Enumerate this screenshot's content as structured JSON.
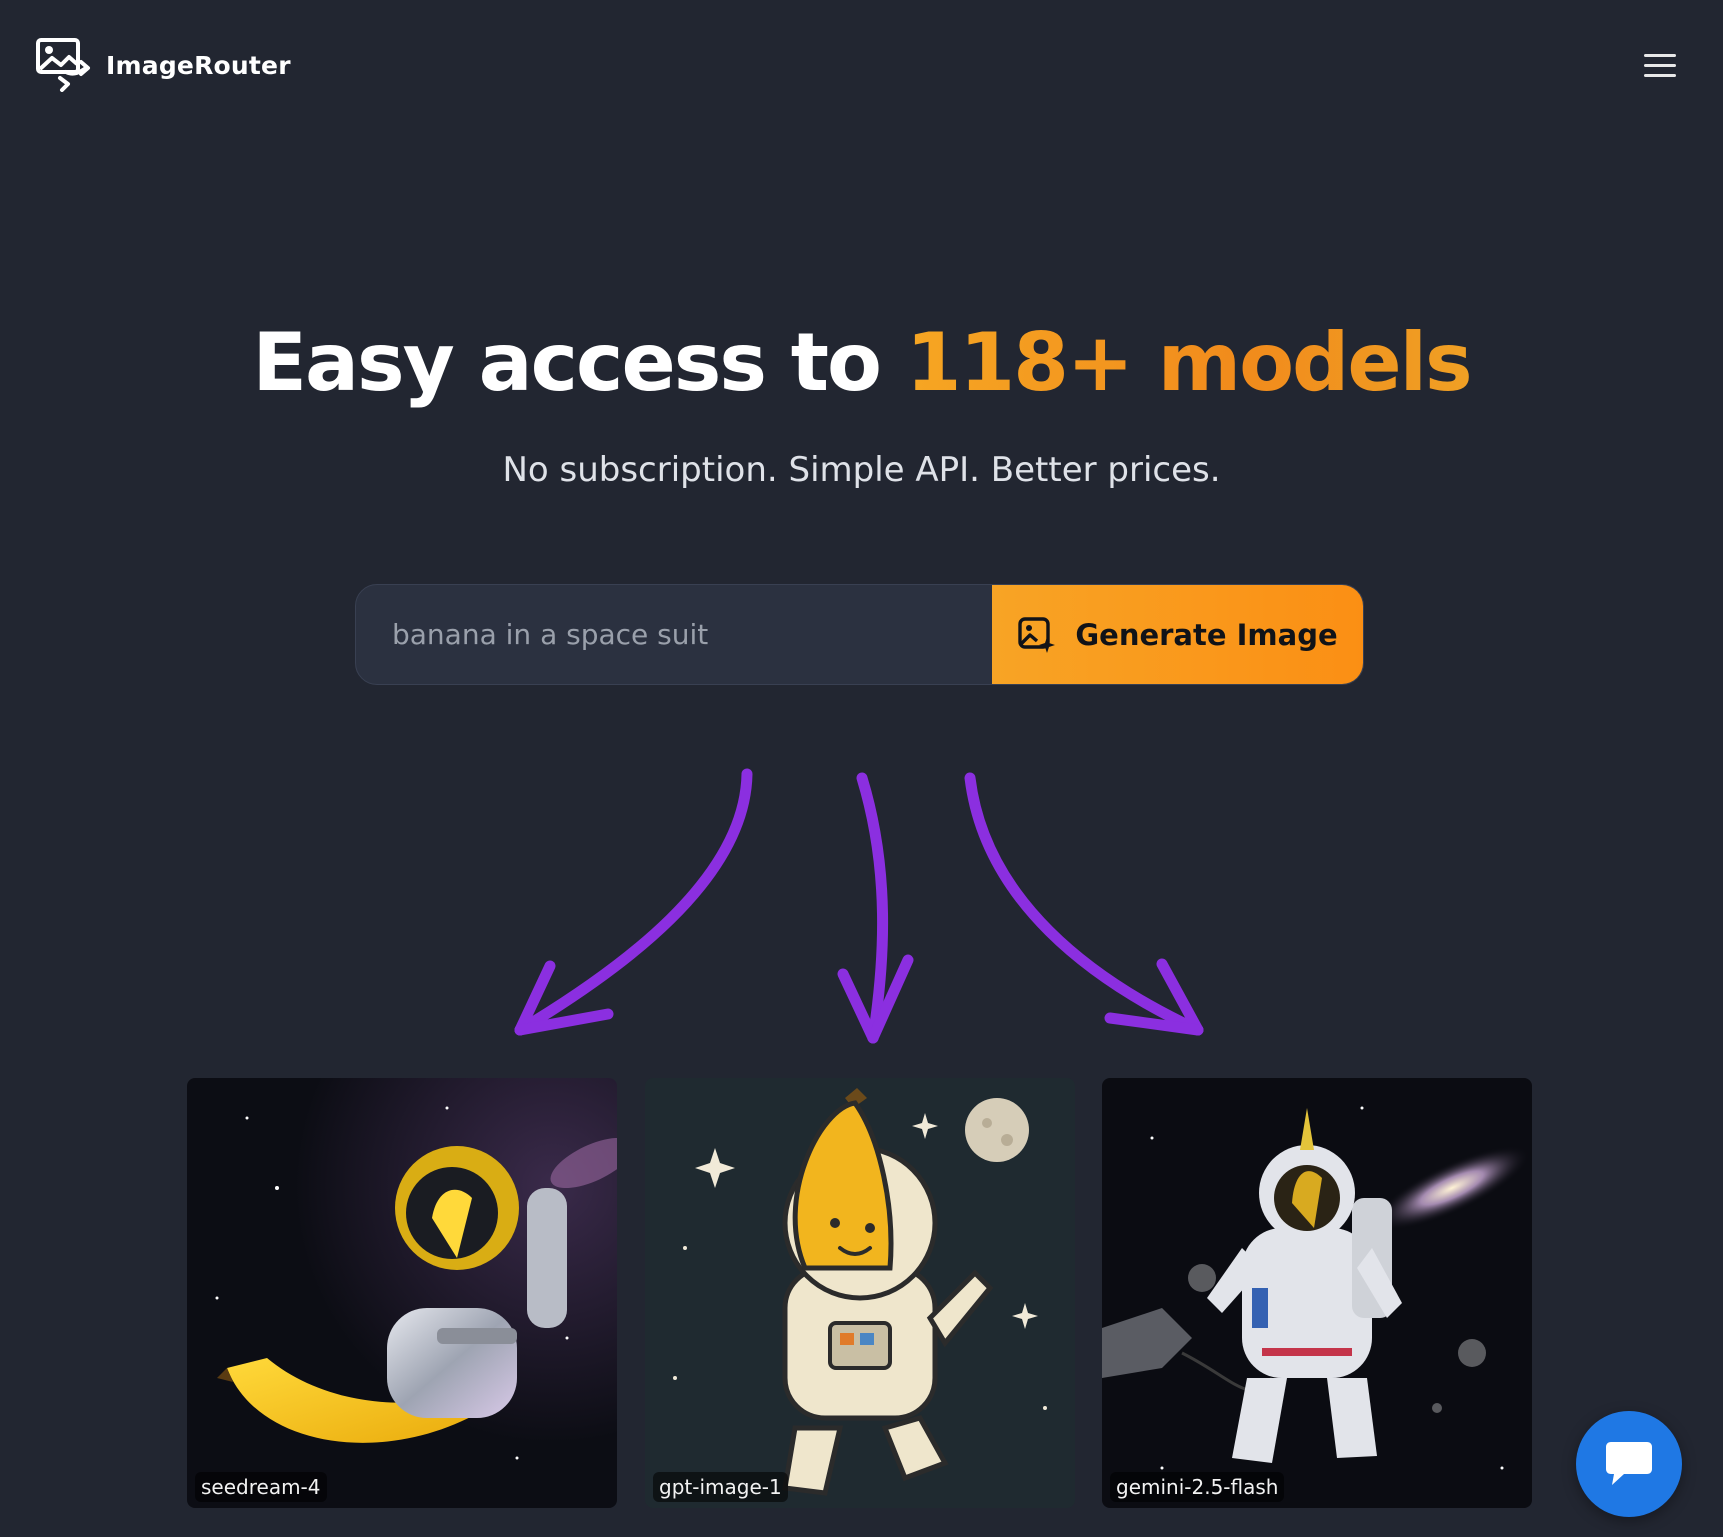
{
  "header": {
    "brand_name": "ImageRouter",
    "logo_icon": "image-route-icon",
    "menu_icon": "hamburger-menu-icon"
  },
  "hero": {
    "title_prefix": "Easy access to ",
    "title_highlight": "118+ models",
    "subtitle": "No subscription. Simple API. Better prices."
  },
  "prompt": {
    "placeholder": "banana in a space suit",
    "value": "",
    "button_label": "Generate Image",
    "button_icon": "image-sparkle-icon"
  },
  "gallery": [
    {
      "model": "seedream-4"
    },
    {
      "model": "gpt-image-1"
    },
    {
      "model": "gemini-2.5-flash"
    }
  ],
  "chat": {
    "icon": "chat-bubble-icon"
  },
  "colors": {
    "background": "#222631",
    "accent_orange": "#fb8f14",
    "arrow_purple": "#8b2fe0",
    "chat_blue": "#1f78e4"
  }
}
